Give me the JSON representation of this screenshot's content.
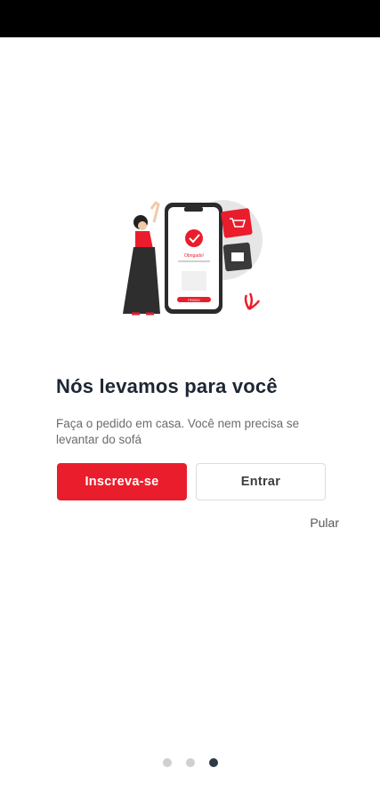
{
  "onboarding": {
    "title": "Nós levamos para você",
    "subtitle": "Faça o pedido em casa. Você nem precisa se levantar do sofá",
    "signup_label": "Inscreva-se",
    "login_label": "Entrar",
    "skip_label": "Pular",
    "illustration": {
      "status_text": "Obrigado!",
      "button_text": "PEDIDO"
    },
    "pager": {
      "total": 3,
      "active_index": 2
    }
  },
  "colors": {
    "accent": "#ea1d2c",
    "title": "#1d2733",
    "dot_active": "#2f3a45",
    "dot_inactive": "#d0d0d0"
  }
}
